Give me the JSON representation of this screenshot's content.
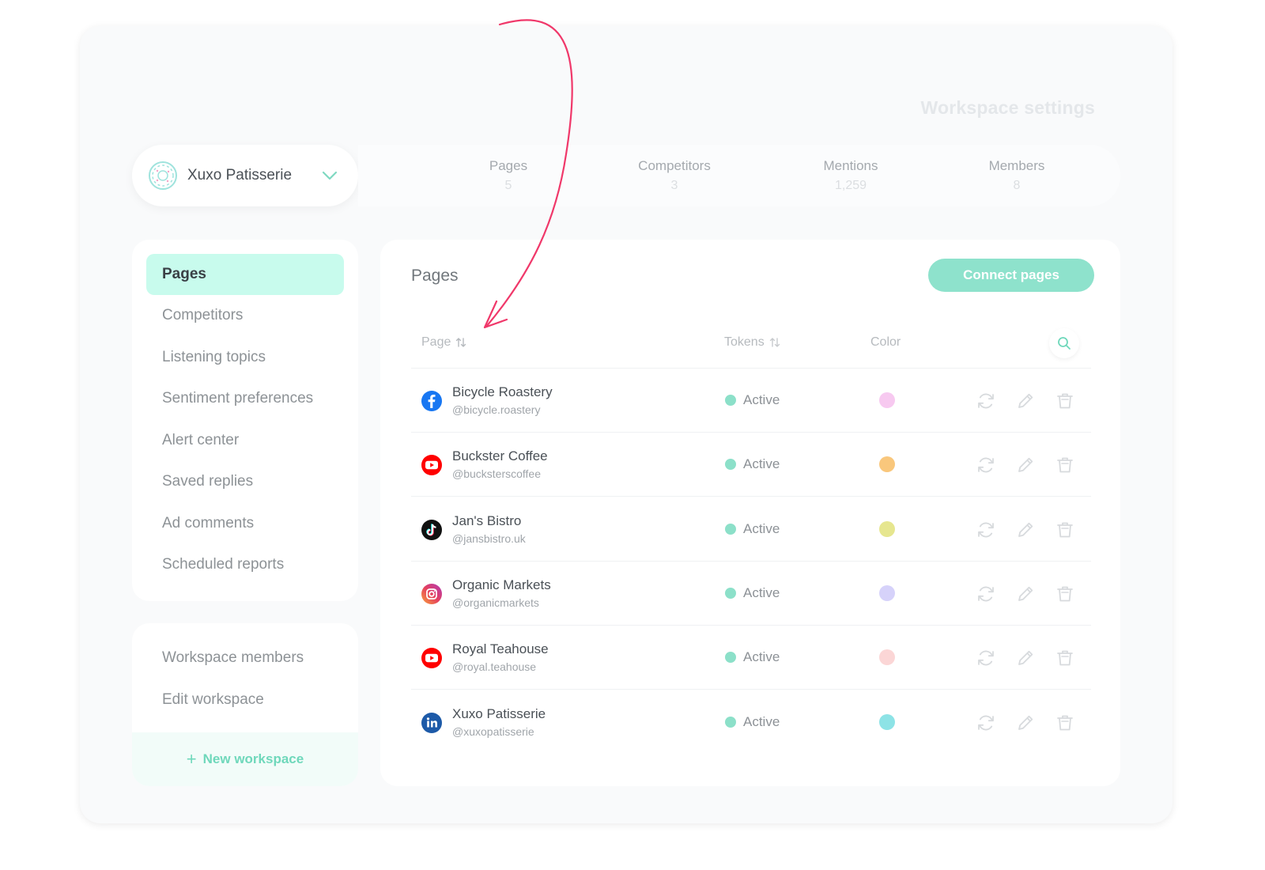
{
  "window": {
    "title": "Workspace settings"
  },
  "workspace": {
    "name": "Xuxo Patisserie"
  },
  "stats": [
    {
      "label": "Pages",
      "value": "5"
    },
    {
      "label": "Competitors",
      "value": "3"
    },
    {
      "label": "Mentions",
      "value": "1,259"
    },
    {
      "label": "Members",
      "value": "8"
    }
  ],
  "nav": {
    "items": [
      {
        "label": "Pages",
        "active": true
      },
      {
        "label": "Competitors"
      },
      {
        "label": "Listening topics"
      },
      {
        "label": "Sentiment preferences"
      },
      {
        "label": "Alert center"
      },
      {
        "label": "Saved replies"
      },
      {
        "label": "Ad comments"
      },
      {
        "label": "Scheduled reports"
      }
    ],
    "secondary": [
      {
        "label": "Workspace members"
      },
      {
        "label": "Edit workspace"
      }
    ],
    "new_workspace_label": "New workspace"
  },
  "pages_panel": {
    "title": "Pages",
    "connect_label": "Connect pages",
    "columns": {
      "page": "Page",
      "tokens": "Tokens",
      "color": "Color"
    },
    "rows": [
      {
        "name": "Bicycle Roastery",
        "handle": "@bicycle.roastery",
        "network": "facebook-icon",
        "status": "Active",
        "color": "#f7c9f0"
      },
      {
        "name": "Buckster Coffee",
        "handle": "@bucksterscoffee",
        "network": "youtube-icon",
        "status": "Active",
        "color": "#f9c77c"
      },
      {
        "name": "Jan's Bistro",
        "handle": "@jansbistro.uk",
        "network": "tiktok-icon",
        "status": "Active",
        "color": "#e6e68f"
      },
      {
        "name": "Organic Markets",
        "handle": "@organicmarkets",
        "network": "instagram-icon",
        "status": "Active",
        "color": "#d6d2fa"
      },
      {
        "name": "Royal Teahouse",
        "handle": "@royal.teahouse",
        "network": "youtube-icon",
        "status": "Active",
        "color": "#fbd6d6"
      },
      {
        "name": "Xuxo Patisserie",
        "handle": "@xuxopatisserie",
        "network": "linkedin-icon",
        "status": "Active",
        "color": "#8de3e6"
      }
    ]
  },
  "colors": {
    "accent": "#8ee2cc",
    "accent_light": "#c8fbed",
    "status_dot": "#8ce0c9",
    "annotation": "#f0386a"
  }
}
